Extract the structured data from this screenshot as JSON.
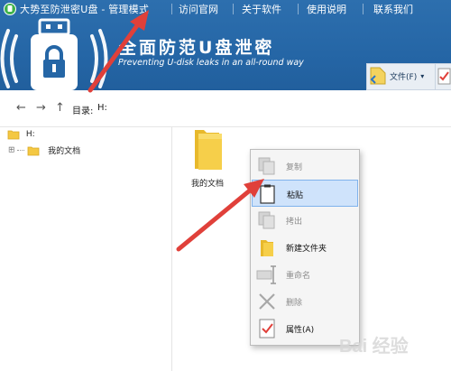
{
  "window": {
    "title": "大势至防泄密U盘 - 管理模式"
  },
  "menu": {
    "items": [
      "访问官网",
      "关于软件",
      "使用说明",
      "联系我们"
    ]
  },
  "brand": {
    "title": "全面防范U盘泄密",
    "subtitle": "Preventing U-disk leaks in an all-round way"
  },
  "toolbar": {
    "file_label": "文件(F)",
    "file_dropdown": "▾"
  },
  "navigation": {
    "back": "←",
    "forward": "→",
    "up": "↑",
    "directory_label": "目录:",
    "directory_value": "H:"
  },
  "tree": {
    "root": "H:",
    "expand": "⊞",
    "child": "我的文档"
  },
  "main": {
    "folder_label": "我的文档"
  },
  "context_menu": {
    "items": [
      {
        "label": "复制",
        "state": "disabled",
        "icon": "copy-icon"
      },
      {
        "label": "粘贴",
        "state": "highlight",
        "icon": "paste-icon"
      },
      {
        "label": "拷出",
        "state": "disabled",
        "icon": "export-icon"
      },
      {
        "label": "新建文件夹",
        "state": "enabled",
        "icon": "new-folder-icon"
      },
      {
        "label": "重命名",
        "state": "disabled",
        "icon": "rename-icon"
      },
      {
        "label": "删除",
        "state": "disabled",
        "icon": "delete-icon"
      },
      {
        "label": "属性(A)",
        "state": "enabled",
        "icon": "properties-icon"
      }
    ]
  },
  "watermark": {
    "text": "Bai 经验"
  },
  "colors": {
    "header_blue": "#2566a6",
    "annotation_red": "#e0403a",
    "highlight": "#cfe3fb",
    "folder_yellow": "#f4c842"
  }
}
